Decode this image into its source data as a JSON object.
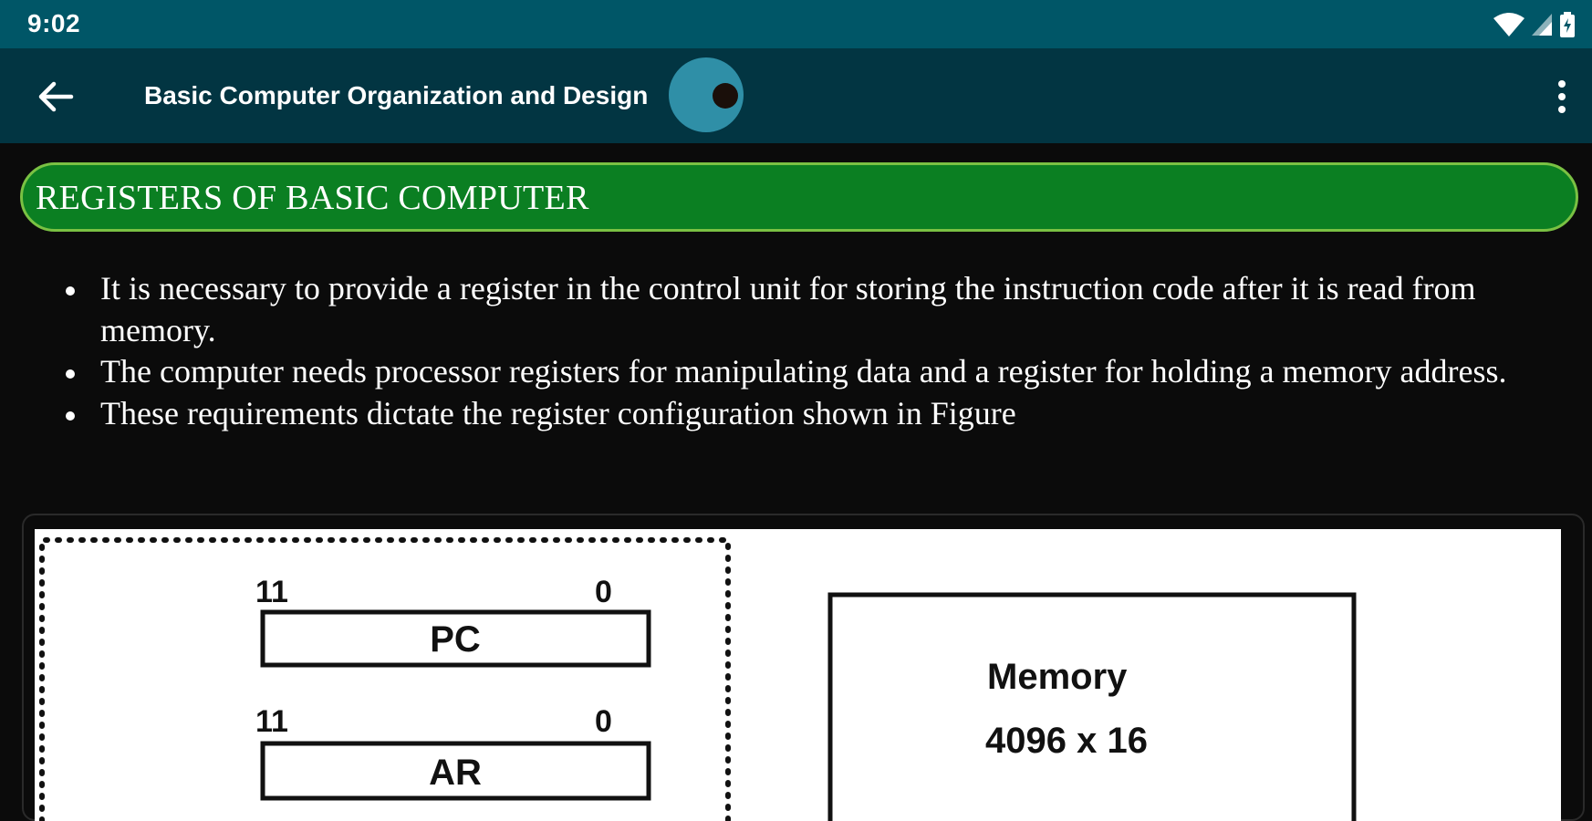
{
  "status_bar": {
    "time": "9:02",
    "icons": [
      "wifi-icon",
      "signal-icon",
      "battery-icon"
    ]
  },
  "app_bar": {
    "title": "Basic Computer Organization and Design",
    "back_icon": "arrow-left-icon",
    "menu_icon": "more-vertical-icon"
  },
  "section": {
    "title": "REGISTERS OF BASIC COMPUTER"
  },
  "bullets": [
    "It is necessary to provide a register in the control unit for storing the instruction code after it is read from memory.",
    "The computer needs processor registers for manipulating data and a register for holding a memory address.",
    "These requirements dictate the register configuration shown in Figure"
  ],
  "figure": {
    "registers": [
      {
        "name": "PC",
        "high_bit": "11",
        "low_bit": "0"
      },
      {
        "name": "AR",
        "high_bit": "11",
        "low_bit": "0"
      }
    ],
    "memory": {
      "label": "Memory",
      "size": "4096 x 16"
    }
  },
  "colors": {
    "status_bar": "#005667",
    "app_bar": "#023542",
    "header_fill": "#0b7f22",
    "header_border": "#7ac143",
    "toggle": "#2f8fa7",
    "background": "#0b0b0b"
  }
}
